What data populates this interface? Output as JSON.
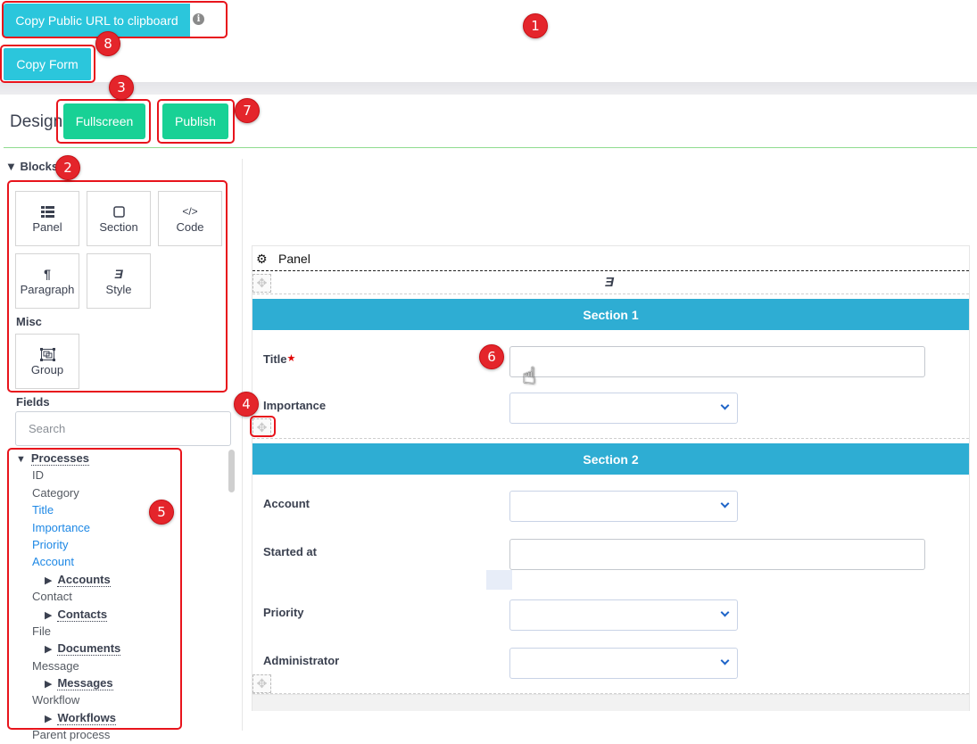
{
  "toolbar": {
    "copy_public_url_label": "Copy Public URL to clipboard",
    "info_icon": "info-circle-icon",
    "copy_form_label": "Copy Form"
  },
  "design_bar": {
    "title": "Design",
    "fullscreen_label": "Fullscreen",
    "publish_label": "Publish"
  },
  "sidebar": {
    "blocks_heading": "▼ Blocks",
    "blocks": [
      {
        "label": "Panel",
        "icon": "list-icon"
      },
      {
        "label": "Section",
        "icon": "square-icon"
      },
      {
        "label": "Code",
        "icon": "code-icon"
      },
      {
        "label": "Paragraph",
        "icon": "paragraph-icon"
      },
      {
        "label": "Style",
        "icon": "css3-icon"
      }
    ],
    "misc_heading": "Misc",
    "misc_blocks": [
      {
        "label": "Group",
        "icon": "group-object-icon"
      }
    ],
    "fields_heading": "Fields",
    "search_placeholder": "Search",
    "tree": {
      "root": "Processes",
      "items": [
        {
          "label": "ID",
          "type": "leaf",
          "linked": false
        },
        {
          "label": "Category",
          "type": "leaf",
          "linked": false
        },
        {
          "label": "Title",
          "type": "leaf",
          "linked": true
        },
        {
          "label": "Importance",
          "type": "leaf",
          "linked": true
        },
        {
          "label": "Priority",
          "type": "leaf",
          "linked": true
        },
        {
          "label": "Account",
          "type": "leaf",
          "linked": true
        },
        {
          "label": "Accounts",
          "type": "group"
        },
        {
          "label": "Contact",
          "type": "leaf",
          "linked": false
        },
        {
          "label": "Contacts",
          "type": "group"
        },
        {
          "label": "File",
          "type": "leaf",
          "linked": false
        },
        {
          "label": "Documents",
          "type": "group"
        },
        {
          "label": "Message",
          "type": "leaf",
          "linked": false
        },
        {
          "label": "Messages",
          "type": "group"
        },
        {
          "label": "Workflow",
          "type": "leaf",
          "linked": false
        },
        {
          "label": "Workflows",
          "type": "group"
        },
        {
          "label": "Parent process",
          "type": "leaf",
          "linked": false
        }
      ]
    }
  },
  "canvas": {
    "panel_title": "Panel",
    "sections": [
      {
        "title": "Section 1",
        "fields": [
          {
            "label": "Title",
            "required": true,
            "type": "text",
            "value": ""
          },
          {
            "label": "Importance",
            "required": false,
            "type": "select",
            "value": ""
          }
        ]
      },
      {
        "title": "Section 2",
        "fields": [
          {
            "label": "Account",
            "required": false,
            "type": "select",
            "value": ""
          },
          {
            "label": "Started at",
            "required": false,
            "type": "text",
            "value": ""
          },
          {
            "label": "Priority",
            "required": false,
            "type": "select",
            "value": ""
          },
          {
            "label": "Administrator",
            "required": false,
            "type": "select",
            "value": ""
          }
        ]
      }
    ]
  },
  "annotations": [
    "1",
    "2",
    "3",
    "4",
    "5",
    "6",
    "7",
    "8"
  ],
  "colors": {
    "info_button": "#2bc6dc",
    "success_button": "#18d195",
    "section_bar": "#2eadd3",
    "linked_field": "#1e88e5",
    "annotation": "#e4252b"
  }
}
